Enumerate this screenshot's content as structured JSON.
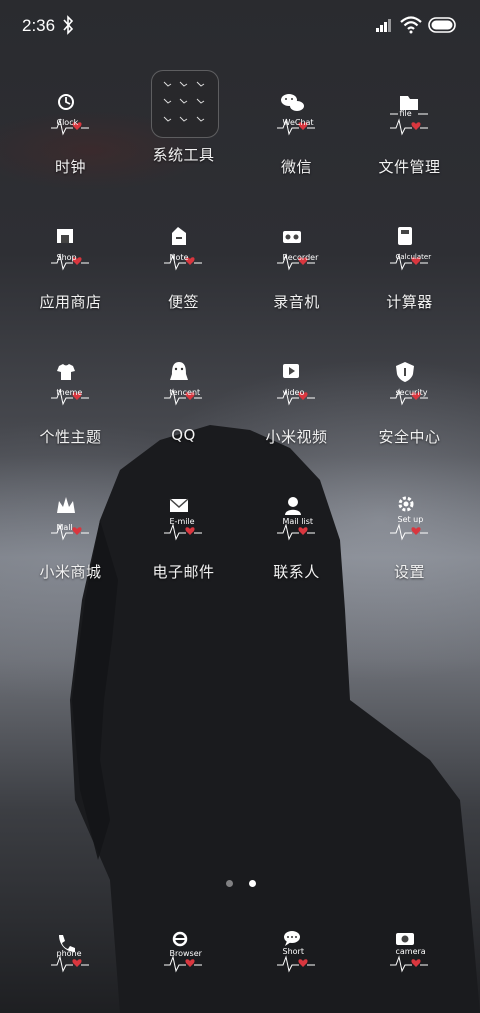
{
  "status": {
    "time": "2:36",
    "icons": [
      "bluetooth-icon",
      "signal-icon",
      "wifi-icon",
      "battery-icon"
    ]
  },
  "apps": [
    {
      "label": "时钟",
      "icon_text": "Clock",
      "icon": "clock-icon"
    },
    {
      "label": "系统工具",
      "icon_text": "",
      "icon": "folder-icon"
    },
    {
      "label": "微信",
      "icon_text": "WeChat",
      "icon": "wechat-icon"
    },
    {
      "label": "文件管理",
      "icon_text": "file",
      "icon": "file-icon"
    },
    {
      "label": "应用商店",
      "icon_text": "Shop",
      "icon": "shop-icon"
    },
    {
      "label": "便签",
      "icon_text": "Note",
      "icon": "note-icon"
    },
    {
      "label": "录音机",
      "icon_text": "Recorder",
      "icon": "recorder-icon"
    },
    {
      "label": "计算器",
      "icon_text": "Calculater",
      "icon": "calculator-icon"
    },
    {
      "label": "个性主题",
      "icon_text": "theme",
      "icon": "theme-icon"
    },
    {
      "label": "QQ",
      "icon_text": "tencent",
      "icon": "qq-icon"
    },
    {
      "label": "小米视频",
      "icon_text": "video",
      "icon": "video-icon"
    },
    {
      "label": "安全中心",
      "icon_text": "security",
      "icon": "security-icon"
    },
    {
      "label": "小米商城",
      "icon_text": "Mall",
      "icon": "mall-icon"
    },
    {
      "label": "电子邮件",
      "icon_text": "E-mile",
      "icon": "email-icon"
    },
    {
      "label": "联系人",
      "icon_text": "Mail list",
      "icon": "contacts-icon"
    },
    {
      "label": "设置",
      "icon_text": "Set up",
      "icon": "settings-icon"
    }
  ],
  "dock": [
    {
      "icon_text": "phone",
      "icon": "phone-icon"
    },
    {
      "icon_text": "Browser",
      "icon": "browser-icon"
    },
    {
      "icon_text": "Short",
      "icon": "messages-icon"
    },
    {
      "icon_text": "camera",
      "icon": "camera-icon"
    }
  ],
  "page_indicator": {
    "pages": 2,
    "current": 2
  },
  "colors": {
    "heart": "#d9363e",
    "label": "#f2f2f2"
  }
}
